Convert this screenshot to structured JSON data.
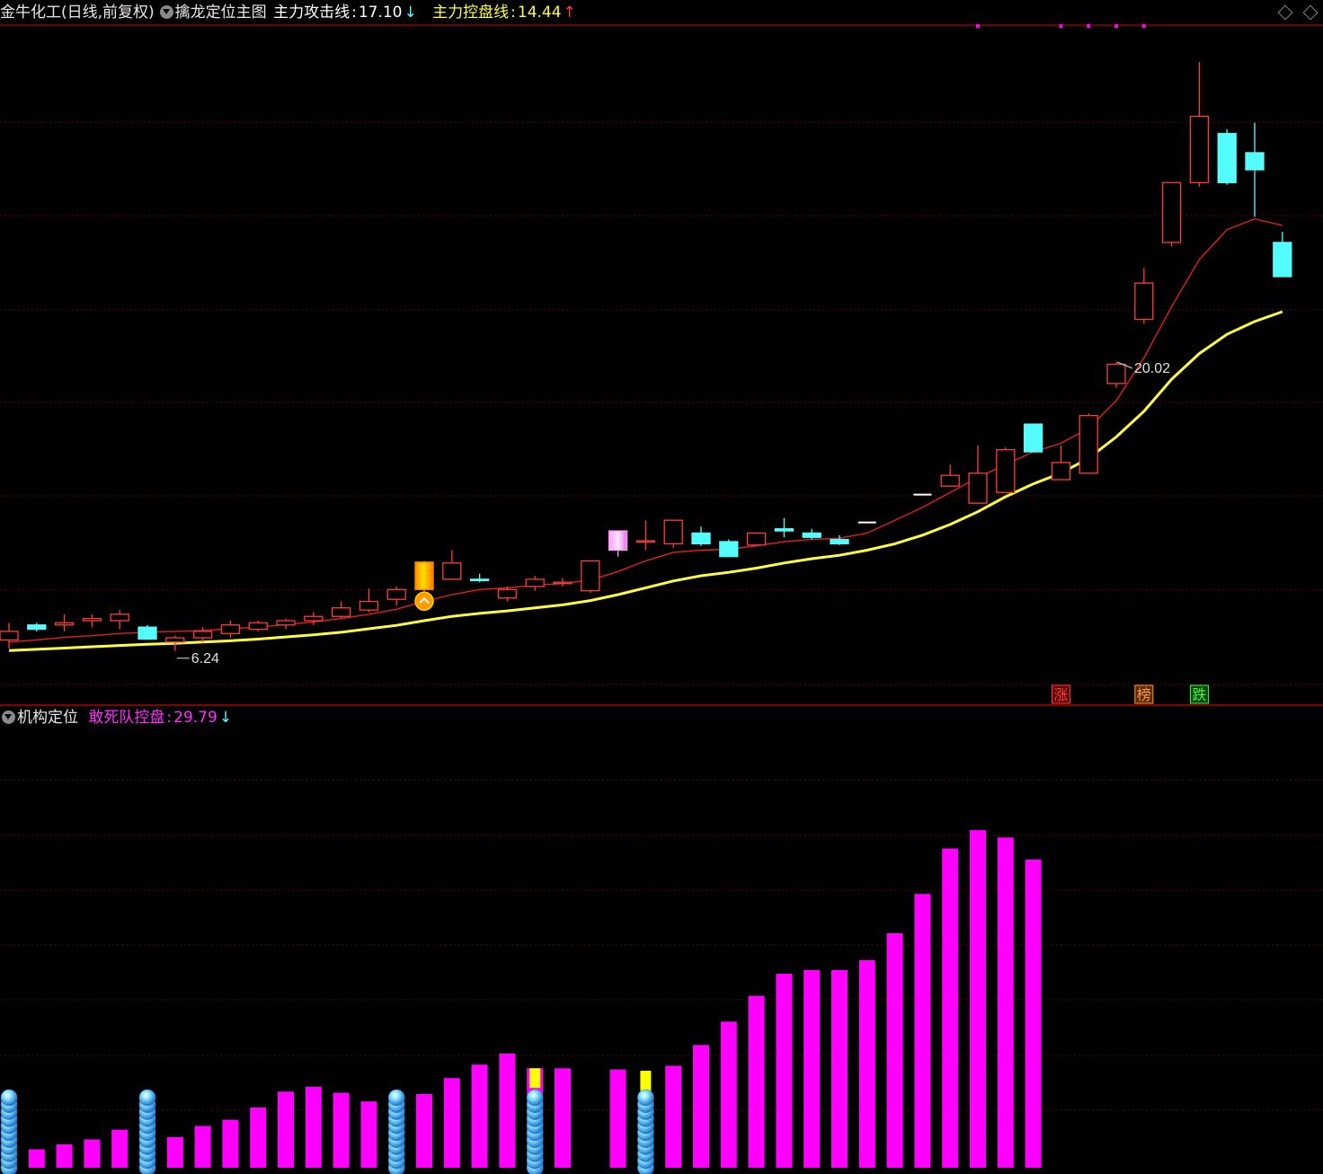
{
  "header_top": {
    "stock": "金牛化工(日线,前复权)",
    "indicator": "擒龙定位主图",
    "line1_label": "主力攻击线",
    "line1_value": "17.10",
    "line1_arrow": "↓",
    "line2_label": "主力控盘线",
    "line2_value": "14.44",
    "line2_arrow": "↑"
  },
  "header_bottom": {
    "indicator": "机构定位",
    "series_label": "敢死队控盘",
    "series_value": "29.79",
    "series_arrow": "↓"
  },
  "colors": {
    "background": "#000000",
    "up": "#ff3c3c",
    "down": "#54fcfc",
    "attack_line": "#e02020",
    "control_line": "#ffff40",
    "bar": "#ff00ff",
    "bar_highlight": "#ffff00",
    "divider": "#b40000"
  },
  "chart_data": [
    {
      "type": "candlestick",
      "title": "",
      "ylim": [
        5.5,
        20.8
      ],
      "grid": true,
      "candles": [
        {
          "o": 6.5,
          "h": 6.9,
          "l": 6.3,
          "c": 6.7
        },
        {
          "o": 6.85,
          "h": 6.9,
          "l": 6.7,
          "c": 6.75
        },
        {
          "o": 6.85,
          "h": 7.1,
          "l": 6.7,
          "c": 6.9
        },
        {
          "o": 6.95,
          "h": 7.1,
          "l": 6.8,
          "c": 7.0
        },
        {
          "o": 6.95,
          "h": 7.2,
          "l": 6.75,
          "c": 7.1
        },
        {
          "o": 6.8,
          "h": 6.85,
          "l": 6.5,
          "c": 6.52
        },
        {
          "o": 6.45,
          "h": 6.6,
          "l": 6.24,
          "c": 6.55
        },
        {
          "o": 6.55,
          "h": 6.8,
          "l": 6.45,
          "c": 6.7
        },
        {
          "o": 6.65,
          "h": 6.95,
          "l": 6.55,
          "c": 6.85
        },
        {
          "o": 6.75,
          "h": 6.95,
          "l": 6.7,
          "c": 6.9
        },
        {
          "o": 6.85,
          "h": 7.0,
          "l": 6.75,
          "c": 6.95
        },
        {
          "o": 6.95,
          "h": 7.15,
          "l": 6.85,
          "c": 7.05
        },
        {
          "o": 7.05,
          "h": 7.4,
          "l": 7.0,
          "c": 7.25
        },
        {
          "o": 7.2,
          "h": 7.7,
          "l": 7.15,
          "c": 7.4
        },
        {
          "o": 7.45,
          "h": 7.75,
          "l": 7.3,
          "c": 7.68
        },
        {
          "o": 7.68,
          "h": 8.35,
          "l": 7.55,
          "c": 8.32,
          "special": "gold"
        },
        {
          "o": 7.92,
          "h": 8.6,
          "l": 7.9,
          "c": 8.3
        },
        {
          "o": 7.92,
          "h": 8.05,
          "l": 7.85,
          "c": 7.9
        },
        {
          "o": 7.48,
          "h": 7.75,
          "l": 7.4,
          "c": 7.68
        },
        {
          "o": 7.75,
          "h": 8.0,
          "l": 7.65,
          "c": 7.92
        },
        {
          "o": 7.82,
          "h": 7.95,
          "l": 7.75,
          "c": 7.85
        },
        {
          "o": 7.65,
          "h": 8.35,
          "l": 7.6,
          "c": 8.35
        },
        {
          "o": 8.6,
          "h": 8.65,
          "l": 8.45,
          "c": 9.05,
          "special": "pink"
        },
        {
          "o": 8.8,
          "h": 9.3,
          "l": 8.6,
          "c": 8.82
        },
        {
          "o": 8.75,
          "h": 9.3,
          "l": 8.65,
          "c": 9.3
        },
        {
          "o": 9.0,
          "h": 9.15,
          "l": 8.7,
          "c": 8.75
        },
        {
          "o": 8.8,
          "h": 8.85,
          "l": 8.5,
          "c": 8.45
        },
        {
          "o": 8.72,
          "h": 9.0,
          "l": 8.7,
          "c": 9.0
        },
        {
          "o": 9.1,
          "h": 9.35,
          "l": 8.9,
          "c": 9.05
        },
        {
          "o": 9.0,
          "h": 9.1,
          "l": 8.85,
          "c": 8.9
        },
        {
          "o": 8.85,
          "h": 8.95,
          "l": 8.72,
          "c": 8.75
        },
        {
          "o": 9.25,
          "h": 9.25,
          "l": 9.25,
          "c": 9.25
        },
        {
          "o": null
        },
        {
          "o": 9.9,
          "h": 9.9,
          "l": 9.9,
          "c": 9.9
        },
        {
          "o": 10.1,
          "h": 10.6,
          "l": 10.1,
          "c": 10.35
        },
        {
          "o": 9.7,
          "h": 11.05,
          "l": 9.7,
          "c": 10.4
        },
        {
          "o": 9.95,
          "h": 11.0,
          "l": 9.95,
          "c": 10.95
        },
        {
          "o": 11.55,
          "h": 11.55,
          "l": 10.95,
          "c": 10.9
        },
        {
          "o": 10.25,
          "h": 11.05,
          "l": 10.25,
          "c": 10.65
        },
        {
          "o": 10.4,
          "h": 11.8,
          "l": 10.4,
          "c": 11.75
        },
        {
          "o": 12.5,
          "h": 13.0,
          "l": 12.4,
          "c": 12.95
        },
        {
          "o": 14.0,
          "h": 15.2,
          "l": 13.9,
          "c": 14.85
        },
        {
          "o": 15.8,
          "h": 16.5,
          "l": 15.7,
          "c": 17.2
        },
        {
          "o": 17.2,
          "h": 20.02,
          "l": 17.1,
          "c": 18.75
        },
        {
          "o": 18.35,
          "h": 18.45,
          "l": 17.15,
          "c": 17.2
        },
        {
          "o": 17.9,
          "h": 18.6,
          "l": 16.4,
          "c": 17.5
        },
        {
          "o": 15.8,
          "h": 16.05,
          "l": 15.0,
          "c": 15.0
        }
      ],
      "attack_line": [
        6.45,
        6.5,
        6.56,
        6.6,
        6.65,
        6.68,
        6.7,
        6.72,
        6.76,
        6.8,
        6.86,
        6.92,
        7.0,
        7.1,
        7.22,
        7.4,
        7.56,
        7.68,
        7.72,
        7.78,
        7.82,
        7.9,
        8.1,
        8.35,
        8.55,
        8.6,
        8.62,
        8.7,
        8.8,
        8.85,
        8.88,
        9.0,
        9.3,
        9.6,
        9.95,
        10.3,
        10.6,
        10.9,
        11.1,
        11.45,
        12.1,
        13.1,
        14.3,
        15.4,
        16.1,
        16.35,
        16.2
      ],
      "control_line": [
        6.25,
        6.28,
        6.31,
        6.34,
        6.37,
        6.4,
        6.42,
        6.45,
        6.48,
        6.52,
        6.57,
        6.62,
        6.68,
        6.76,
        6.84,
        6.95,
        7.05,
        7.12,
        7.18,
        7.25,
        7.32,
        7.42,
        7.56,
        7.72,
        7.88,
        8.0,
        8.08,
        8.18,
        8.3,
        8.4,
        8.48,
        8.6,
        8.75,
        8.95,
        9.2,
        9.5,
        9.85,
        10.15,
        10.4,
        10.75,
        11.25,
        11.85,
        12.6,
        13.2,
        13.65,
        13.95,
        14.18
      ],
      "annotations": [
        {
          "text": "20.02"
        },
        {
          "text": "6.24"
        }
      ],
      "markers": [
        "涨",
        "榜",
        "跌"
      ]
    },
    {
      "type": "bar",
      "title": "",
      "ylim": [
        0,
        30
      ],
      "grid": true,
      "values": [
        0,
        1.5,
        1.9,
        2.3,
        3.1,
        0,
        2.5,
        3.4,
        3.9,
        4.9,
        6.2,
        6.6,
        6.1,
        5.4,
        0,
        6.0,
        7.3,
        8.4,
        9.3,
        8.1,
        8.1,
        null,
        8.0,
        0,
        8.3,
        10.0,
        11.9,
        14.0,
        15.8,
        16.1,
        16.1,
        16.9,
        19.1,
        22.3,
        26.0,
        27.5,
        26.9,
        25.1
      ],
      "highlight": [
        null,
        null,
        null,
        null,
        null,
        null,
        null,
        null,
        null,
        null,
        null,
        null,
        null,
        null,
        null,
        null,
        null,
        null,
        null,
        {
          "from": 6.5,
          "to": 8.1
        },
        null,
        null,
        null,
        {
          "from": 6.2,
          "to": 7.9
        },
        null,
        null,
        null,
        null,
        null,
        null,
        null,
        null,
        null,
        null,
        null,
        null,
        null,
        null
      ],
      "ball_stacks": [
        0,
        5,
        14,
        19,
        23
      ]
    }
  ]
}
